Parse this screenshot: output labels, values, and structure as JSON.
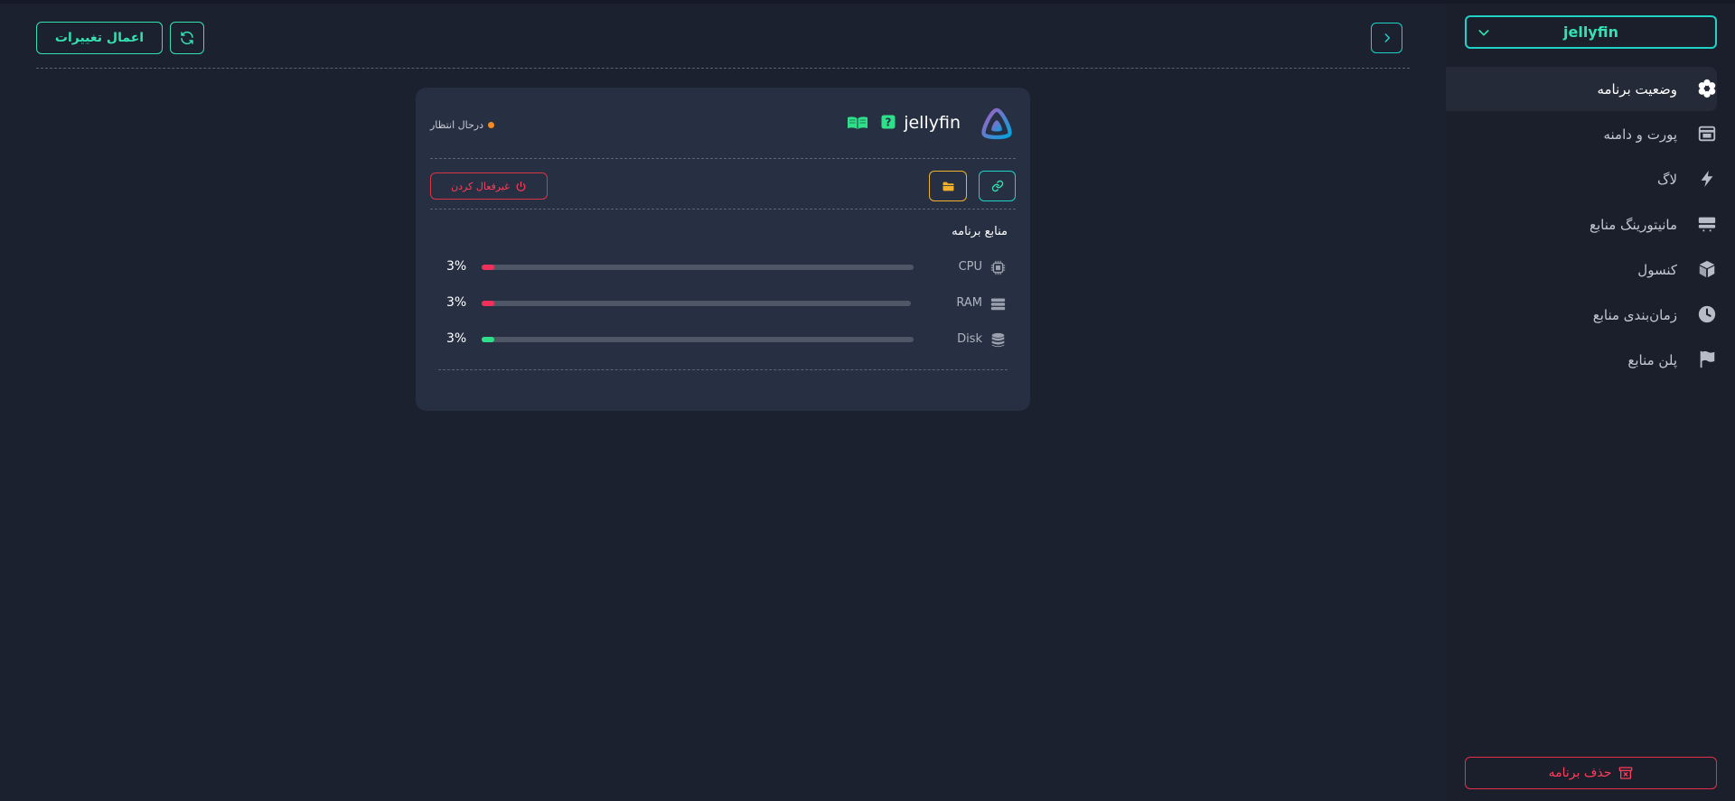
{
  "app_selector": {
    "value": "jellyfin",
    "icon": "chevron-down-icon"
  },
  "sidebar": {
    "items": [
      {
        "label": "وضعیت برنامه",
        "icon": "gear-flower-icon",
        "active": true
      },
      {
        "label": "پورت و دامنه",
        "icon": "browser-window-icon",
        "active": false
      },
      {
        "label": "لاگ",
        "icon": "bolt-icon",
        "active": false
      },
      {
        "label": "مانیتورینگ منابع",
        "icon": "server-icon",
        "active": false
      },
      {
        "label": "کنسول",
        "icon": "cube-icon",
        "active": false
      },
      {
        "label": "زمان‌بندی منابع",
        "icon": "clock-icon",
        "active": false
      },
      {
        "label": "پلن منابع",
        "icon": "flag-icon",
        "active": false
      }
    ],
    "delete_label": "حذف برنامه"
  },
  "header": {
    "apply_label": "اعمال تغییرات"
  },
  "card": {
    "app_name": "jellyfin",
    "status_text": "درحال انتظار",
    "status_color": "#f58a1f",
    "disable_label": "غیرفعال کردن",
    "resources_title": "منابع برنامه",
    "resources": [
      {
        "label": "CPU",
        "value": "3%",
        "percent": 3,
        "color": "#f0305a",
        "icon": "chip-icon"
      },
      {
        "label": "RAM",
        "value": "3%",
        "percent": 3,
        "color": "#f0305a",
        "icon": "memory-icon"
      },
      {
        "label": "Disk",
        "value": "3%",
        "percent": 3,
        "color": "#2ee08a",
        "icon": "database-icon"
      }
    ]
  },
  "colors": {
    "accent_teal": "#1fd1c6",
    "accent_green": "#35e1b1",
    "danger": "#ff3c5a",
    "warning": "#f2b12d"
  }
}
